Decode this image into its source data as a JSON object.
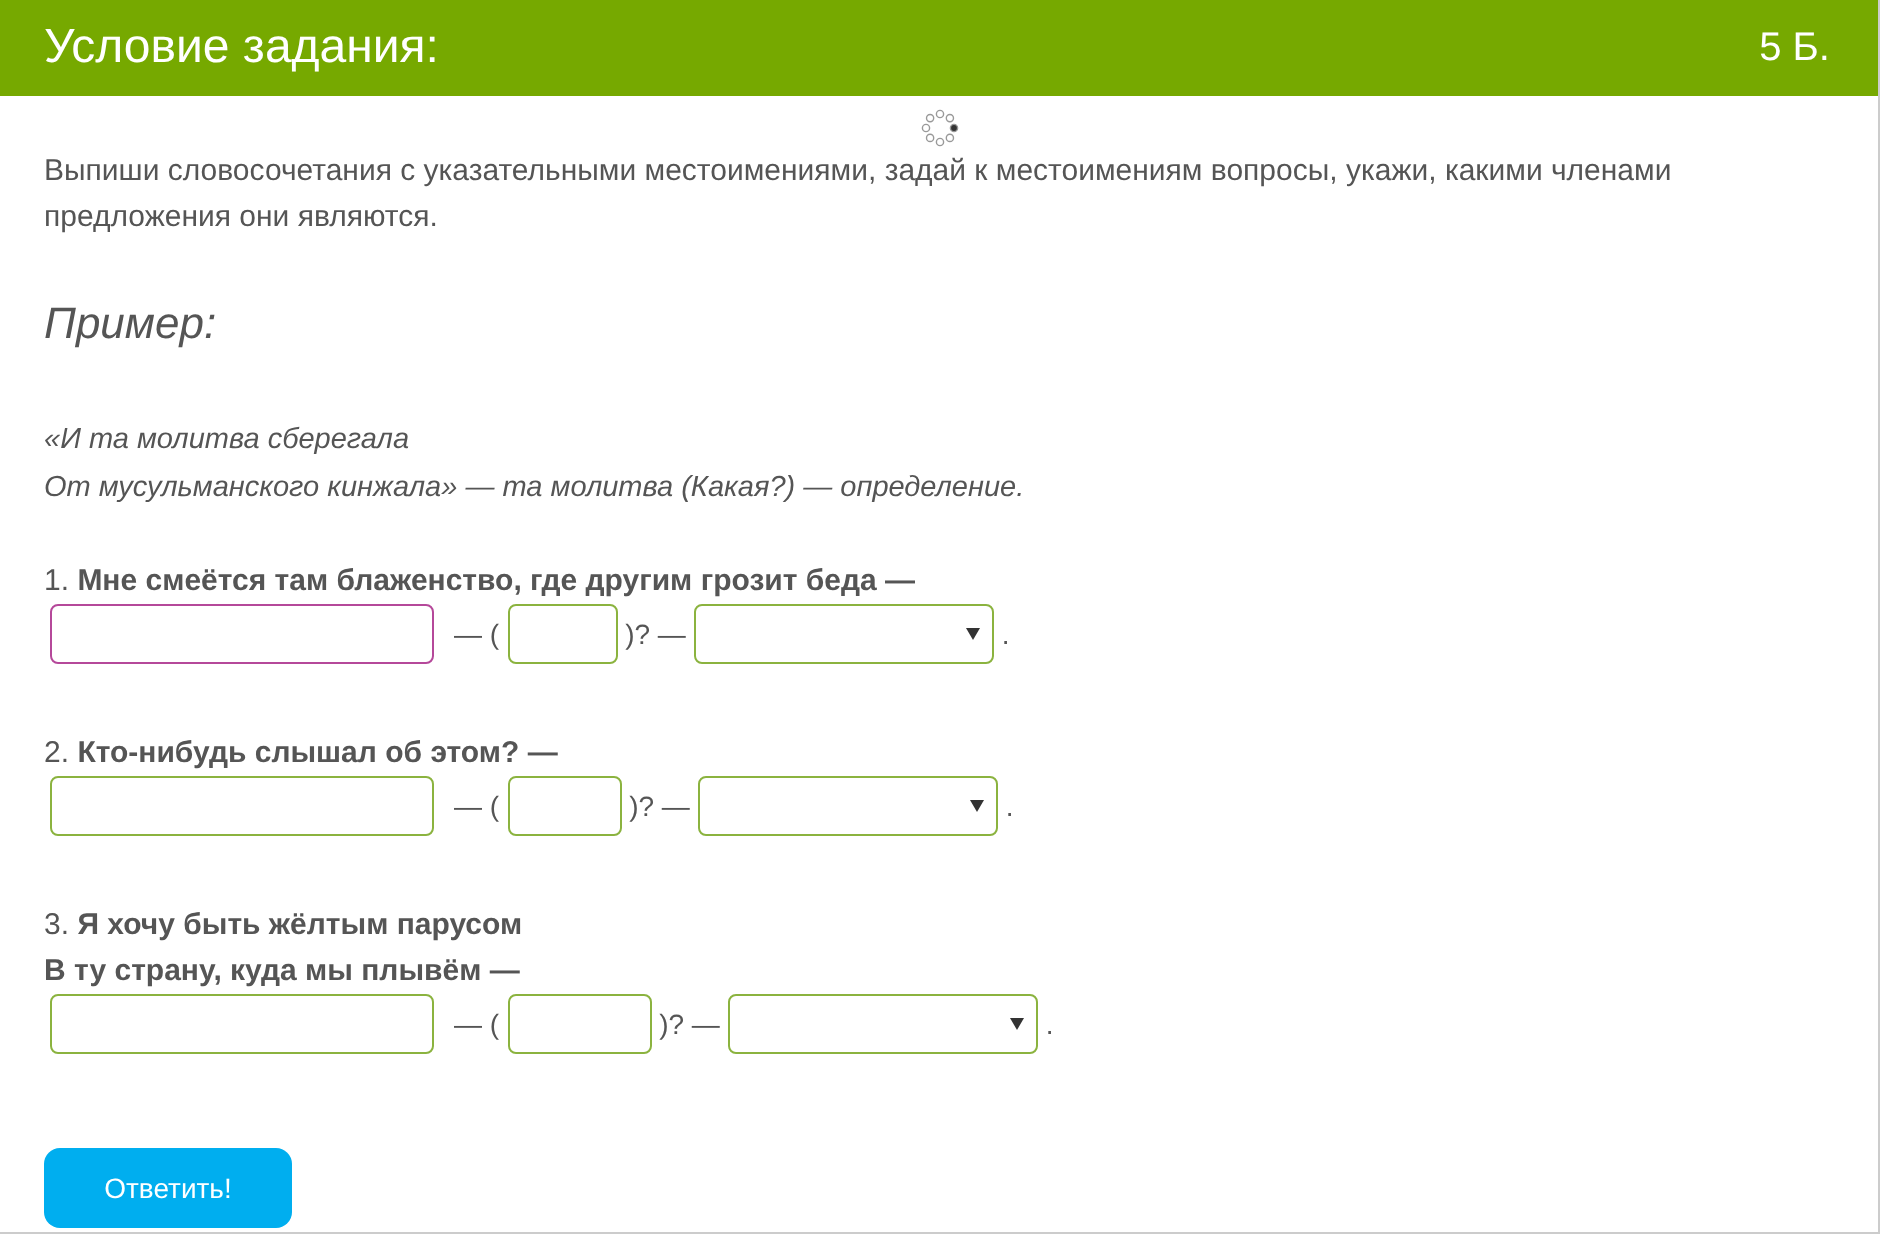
{
  "header": {
    "title": "Условие задания:",
    "score": "5 Б."
  },
  "loading": true,
  "instruction": "Выпиши словосочетания с указательными местоимениями, задай к местоимениям вопросы, укажи, какими членами предложения они являются.",
  "example": {
    "heading": "Пример:",
    "lines": [
      "«И та молитва сберегала",
      "От мусульманского кинжала» — та молитва (Какая?) — определение."
    ]
  },
  "items": [
    {
      "lines": [
        "1. **Мне смеётся там блаженство, где другим грозит беда —**"
      ],
      "answer": {
        "focused": true
      },
      "sep_open": "— (",
      "question": {
        "focused": false
      },
      "sep_close": ")? —",
      "select": {
        "focused": false
      },
      "end": "."
    },
    {
      "lines": [
        "2. **Кто-нибудь слышал об этом? —**"
      ],
      "answer": {
        "focused": false
      },
      "sep_open": "— (",
      "question": {
        "focused": false
      },
      "sep_close": ")? —",
      "select": {
        "focused": false
      },
      "end": "."
    },
    {
      "lines": [
        "3. **Я хочу быть жёлтым парусом**",
        "**В ту страну, куда мы плывём —**"
      ],
      "answer": {
        "focused": false
      },
      "sep_open": "— (",
      "question": {
        "focused": false
      },
      "sep_close": ")? —",
      "select": {
        "focused": false
      },
      "end": "."
    }
  ],
  "submit": "Ответить!"
}
